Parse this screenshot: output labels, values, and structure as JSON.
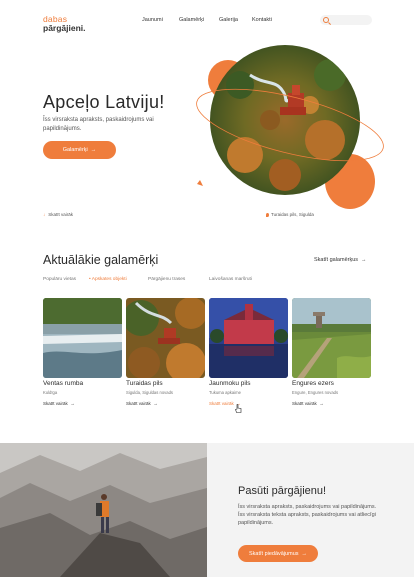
{
  "brand": {
    "line1": "dabas",
    "line2": "pārgājieni."
  },
  "nav": {
    "items": [
      "Jaunumi",
      "Galamērķi",
      "Galerija",
      "Kontakti"
    ]
  },
  "search": {
    "placeholder": ""
  },
  "hero": {
    "title": "Apceļo Latviju!",
    "subtitle": "Īss virsraksta apraksts, paskaidrojums vai papildinājums.",
    "button_label": "Galamērķi",
    "scroll_label": "Skatīt vairāk",
    "caption": "Turaidas pils, Sigulda"
  },
  "popular": {
    "title": "Aktuālākie galamērķi",
    "see_all": "Skatīt galamērķus",
    "filters": [
      "Populāru vietas",
      "• Apskates objekti",
      "Pārgājienu trases",
      "Laivošanas maršruti"
    ],
    "cards": [
      {
        "title": "Ventas rumba",
        "sub": "Kuldīga",
        "link": "Skatīt vairāk"
      },
      {
        "title": "Turaidas pils",
        "sub": "Sigulda, Siguldas novads",
        "link": "Skatīt vairāk"
      },
      {
        "title": "Jaunmoku pils",
        "sub": "Tukuma apkaime",
        "link": "Skatīt vairāk"
      },
      {
        "title": "Engures ezers",
        "sub": "Engure, Engures novads",
        "link": "Skatīt vairāk"
      }
    ]
  },
  "cta": {
    "title": "Pasūti pārgājienu!",
    "text": "Īss virsraksta apraksts, paskaidrojums vai papildinājums. Īss virsraksta teksta apraksts, paskaidrojums vai atliecīgi papildinājums.",
    "button_label": "Skatīt piedāvājumus"
  },
  "icons": {
    "search": "search-icon",
    "arrow": "arrow-right-icon",
    "pin": "map-pin-icon",
    "cursor": "hand-pointer-icon"
  },
  "colors": {
    "accent": "#ef7d3c",
    "panel": "#f3f3f3",
    "text": "#2a2a2a"
  }
}
